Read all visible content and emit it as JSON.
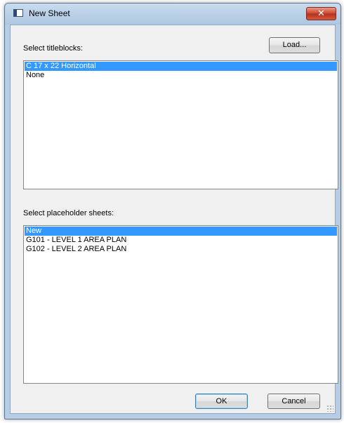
{
  "window": {
    "title": "New Sheet",
    "close_symbol": "✕"
  },
  "titleblocks": {
    "label": "Select titleblocks:",
    "load_button": "Load...",
    "items": [
      {
        "label": "C 17 x 22 Horizontal",
        "selected": true
      },
      {
        "label": "None",
        "selected": false
      }
    ]
  },
  "placeholders": {
    "label": "Select placeholder sheets:",
    "items": [
      {
        "label": "New",
        "selected": true
      },
      {
        "label": "G101 - LEVEL 1 AREA PLAN",
        "selected": false
      },
      {
        "label": "G102 - LEVEL 2 AREA PLAN",
        "selected": false
      }
    ]
  },
  "buttons": {
    "ok": "OK",
    "cancel": "Cancel"
  },
  "colors": {
    "selection": "#3399ff",
    "close_button": "#c8432c"
  }
}
